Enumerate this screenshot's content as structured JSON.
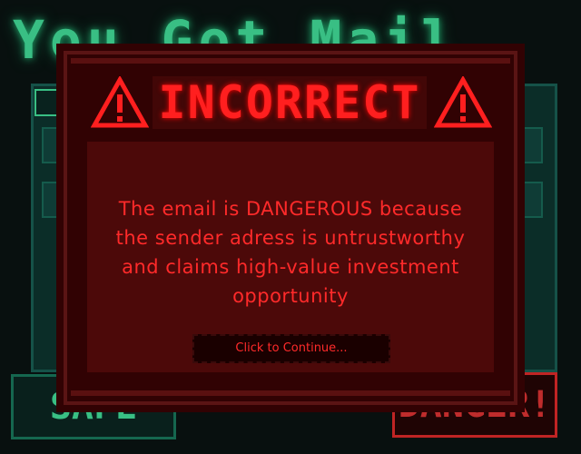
{
  "background": {
    "title": "You Got Mail",
    "safe_button": "SAFE",
    "danger_button": "DANGER!"
  },
  "modal": {
    "title": "INCORRECT",
    "message": "The email is DANGEROUS because the sender adress is untrustworthy and claims high-value investment opportunity",
    "continue_label": "Click to Continue...",
    "icons": [
      "warning-icon",
      "warning-icon"
    ]
  },
  "colors": {
    "accent_red": "#ff1f1f",
    "modal_bg": "#310203",
    "bg_green": "#4dffb0"
  }
}
